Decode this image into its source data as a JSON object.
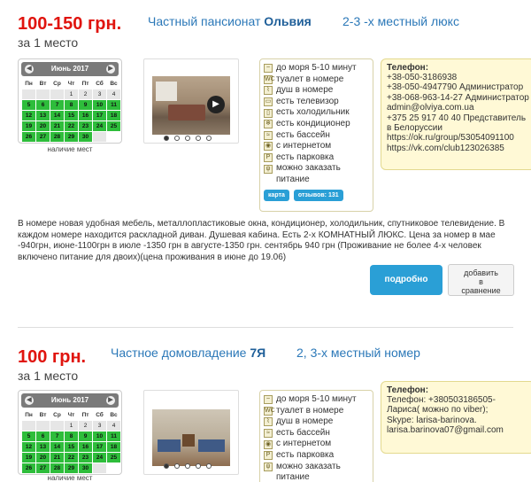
{
  "listings": [
    {
      "price": "100-150 грн.",
      "per": "за 1 место",
      "title_prefix": "Частный пансионат",
      "title_name": "Ольвия",
      "room_type": "2-3 -х местный люкс",
      "calendar": {
        "month": "Июнь 2017",
        "day_headers": [
          "Пн",
          "Вт",
          "Ср",
          "Чт",
          "Пт",
          "Сб",
          "Вс"
        ],
        "note": "наличие мест"
      },
      "amenities": [
        {
          "icon": "sea-distance-icon",
          "label": "до моря 5-10 минут"
        },
        {
          "icon": "toilet-icon",
          "label": "туалет в номере"
        },
        {
          "icon": "shower-icon",
          "label": "душ в номере"
        },
        {
          "icon": "tv-icon",
          "label": "есть телевизор"
        },
        {
          "icon": "fridge-icon",
          "label": "есть холодильник"
        },
        {
          "icon": "ac-icon",
          "label": "есть кондиционер"
        },
        {
          "icon": "pool-icon",
          "label": "есть бассейн"
        },
        {
          "icon": "wifi-icon",
          "label": "с интернетом"
        },
        {
          "icon": "parking-icon",
          "label": "есть парковка"
        },
        {
          "icon": "food-icon",
          "label": "можно заказать"
        },
        {
          "icon": "",
          "label": "питание"
        }
      ],
      "tag_map": "карта",
      "tag_reviews": "отзывов: 131",
      "contact_label": "Телефон:",
      "contact_lines": [
        "+38-050-3186938",
        "+38-050-4947790 Администратор",
        "+38-068-963-14-27 Администратор",
        "admin@olviya.com.ua",
        "+375 25 917 40 40 Представитель",
        "в Белоруссии",
        "https://ok.ru/group/53054091100",
        "https://vk.com/club123026385"
      ],
      "description": "В номере новая удобная мебель, металлопластиковые окна, кондиционер, холодильник, спутниковое телевидение. В каждом номере находится раскладной диван. Душевая кабина. Есть 2-х КОМНАТНЫЙ ЛЮКС. Цена за номер в мае -940грн, июне-1100грн в июле -1350 грн в августе-1350 грн. сентябрь 940 грн (Проживание не более 4-х человек включено питание для двоих)(цена проживания в июне до 19.06)",
      "more_button": "подробно",
      "compare_button": [
        "добавить",
        "в",
        "сравнение"
      ]
    },
    {
      "price": "100 грн.",
      "per": "за 1 место",
      "title_prefix": "Частное домовладение",
      "title_name": "7Я",
      "room_type": "2, 3-х местный номер",
      "calendar": {
        "month": "Июнь 2017",
        "day_headers": [
          "Пн",
          "Вт",
          "Ср",
          "Чт",
          "Пт",
          "Сб",
          "Вс"
        ],
        "note": "наличие мест"
      },
      "amenities": [
        {
          "icon": "sea-distance-icon",
          "label": "до моря 5-10 минут"
        },
        {
          "icon": "toilet-icon",
          "label": "туалет в номере"
        },
        {
          "icon": "shower-icon",
          "label": "душ в номере"
        },
        {
          "icon": "pool-icon",
          "label": "есть бассейн"
        },
        {
          "icon": "wifi-icon",
          "label": "с интернетом"
        },
        {
          "icon": "parking-icon",
          "label": "есть парковка"
        },
        {
          "icon": "food-icon",
          "label": "можно заказать"
        },
        {
          "icon": "",
          "label": "питание"
        }
      ],
      "contact_label": "Телефон:",
      "contact_lines": [
        "Телефон: +380503186505-",
        "Лариса( можно по viber);",
        "Skype: larisa-barinova.",
        "larisa.barinova07@gmail.com"
      ]
    }
  ]
}
